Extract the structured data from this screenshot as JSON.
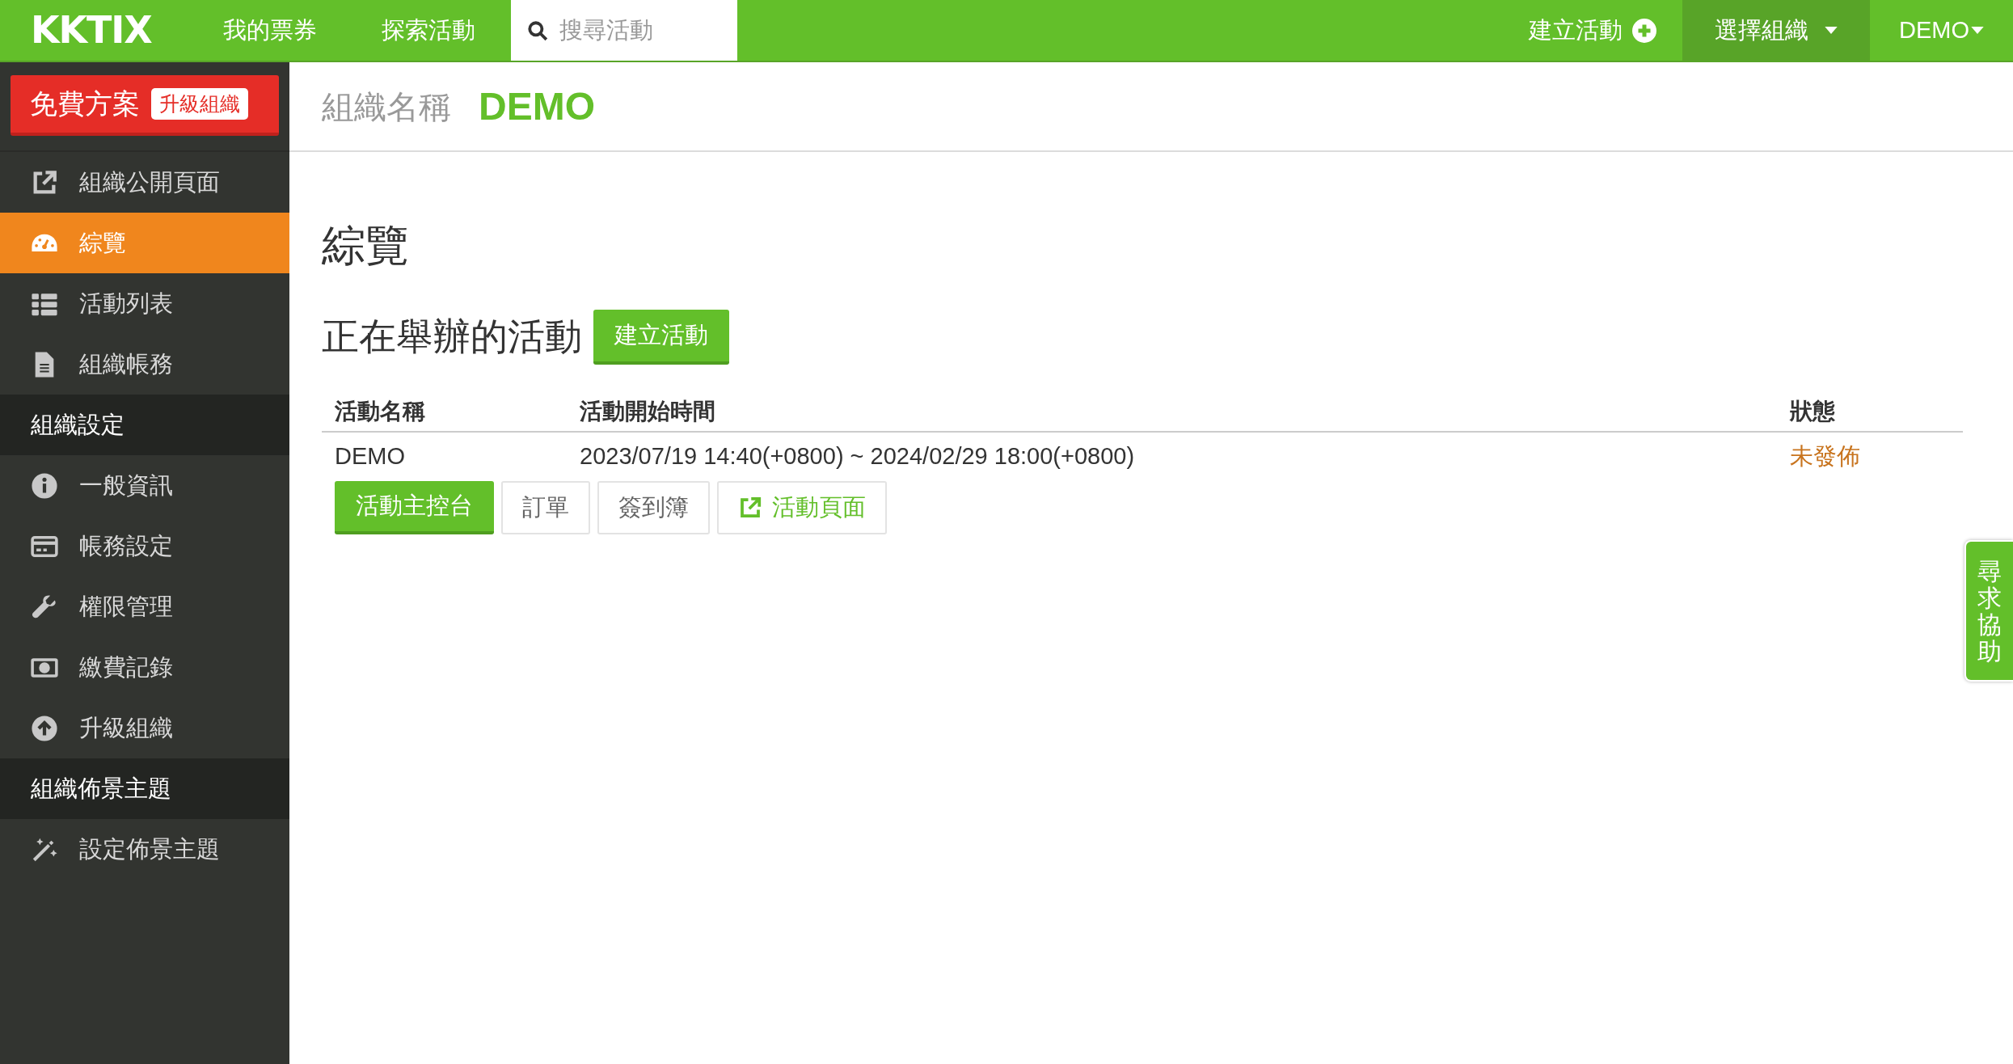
{
  "topbar": {
    "logo": "KKTIX",
    "links": [
      {
        "label": "我的票券"
      },
      {
        "label": "探索活動"
      }
    ],
    "search": {
      "placeholder": "搜尋活動"
    },
    "create": "建立活動",
    "org_menu": {
      "label": "選擇組織",
      "selected": true
    },
    "user_menu": {
      "label": "DEMO"
    }
  },
  "sidebar": {
    "plan": {
      "label": "免費方案",
      "badge": "升級組織"
    },
    "items": [
      {
        "kind": "link",
        "label": "組織公開頁面",
        "selected": false
      },
      {
        "kind": "link",
        "label": "綜覽",
        "selected": true
      },
      {
        "kind": "link",
        "label": "活動列表",
        "selected": false
      },
      {
        "kind": "link",
        "label": "組織帳務",
        "selected": false
      },
      {
        "kind": "header",
        "label": "組織設定"
      },
      {
        "kind": "link",
        "label": "一般資訊",
        "selected": false
      },
      {
        "kind": "link",
        "label": "帳務設定",
        "selected": false
      },
      {
        "kind": "link",
        "label": "權限管理",
        "selected": false
      },
      {
        "kind": "link",
        "label": "繳費記錄",
        "selected": false
      },
      {
        "kind": "link",
        "label": "升級組織",
        "selected": false
      },
      {
        "kind": "header",
        "label": "組織佈景主題"
      },
      {
        "kind": "link",
        "label": "設定佈景主題",
        "selected": false
      }
    ]
  },
  "page_header": {
    "label": "組織名稱",
    "name": "DEMO"
  },
  "main": {
    "title": "綜覽",
    "section": "正在舉辦的活動",
    "create_button": "建立活動",
    "table": {
      "columns": [
        "活動名稱",
        "活動開始時間",
        "狀態"
      ],
      "rows": [
        {
          "name": "DEMO",
          "time": "2023/07/19 14:40(+0800) ~ 2024/02/29 18:00(+0800)",
          "status": "未發佈",
          "color": "#c8741e",
          "actions": [
            {
              "kind": "primary",
              "label": "活動主控台"
            },
            {
              "kind": "plain",
              "label": "訂單"
            },
            {
              "kind": "plain",
              "label": "簽到簿"
            },
            {
              "kind": "link",
              "label": "活動頁面"
            }
          ]
        }
      ]
    }
  },
  "help_tab": "尋求協助"
}
